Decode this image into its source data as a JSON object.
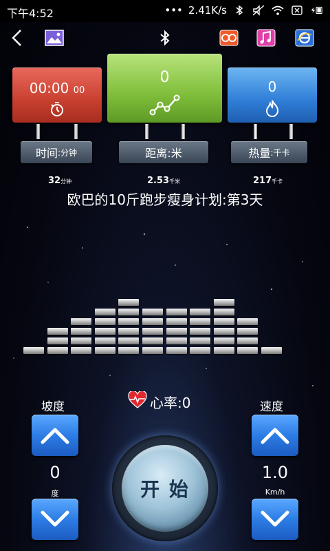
{
  "status": {
    "time": "下午4:52",
    "network_speed": "2.41K/s"
  },
  "cards": {
    "time": {
      "value": "00:00",
      "value_small": "00",
      "label": "时间",
      "unit": ":分钟",
      "color": "#d84a3b"
    },
    "distance": {
      "value": "0",
      "label": "距离",
      "unit": ":米",
      "color": "#7fbe3a"
    },
    "calories": {
      "value": "0",
      "label": "热量",
      "unit": ":千卡",
      "color": "#2f7ed8"
    }
  },
  "stats": {
    "time": {
      "value": "32",
      "unit": "分钟"
    },
    "distance": {
      "value": "2.53",
      "unit": "千米"
    },
    "calories": {
      "value": "217",
      "unit": "千卡"
    }
  },
  "plan_title": "欧巴的10斤跑步瘦身计划:第3天",
  "equalizer_levels": [
    1,
    3,
    4,
    5,
    6,
    5,
    5,
    5,
    6,
    4,
    1
  ],
  "heart_rate": "心率:0",
  "slope": {
    "label": "坡度",
    "value": "0",
    "unit": "度"
  },
  "speed": {
    "label": "速度",
    "value": "1.0",
    "unit": "Km/h"
  },
  "start_label": "开 始",
  "icons": {
    "status": [
      "bluetooth-icon",
      "mute-icon",
      "wifi-icon",
      "no-sim-icon",
      "battery-icon"
    ],
    "topbar": [
      "back-icon",
      "gallery-icon",
      "bluetooth-icon",
      "video-icon",
      "music-icon",
      "ie-icon"
    ]
  }
}
